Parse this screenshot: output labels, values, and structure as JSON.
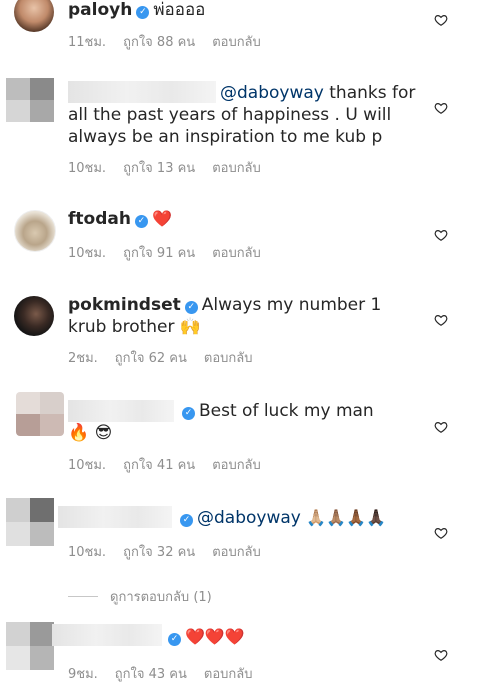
{
  "comments": [
    {
      "username": "paloyh",
      "text": "พ่ออออ",
      "time": "11ชม.",
      "likes": "ถูกใจ 88 คน",
      "reply": "ตอบกลับ"
    },
    {
      "username": "",
      "mention": "@daboyway",
      "text": "thanks for all the past years of happiness . U will always be an inspiration to me kub p",
      "time": "10ชม.",
      "likes": "ถูกใจ 13 คน",
      "reply": "ตอบกลับ"
    },
    {
      "username": "ftodah",
      "text": "❤️",
      "time": "10ชม.",
      "likes": "ถูกใจ 91 คน",
      "reply": "ตอบกลับ"
    },
    {
      "username": "pokmindset",
      "text": "Always my number 1 krub brother 🙌",
      "time": "2ชม.",
      "likes": "ถูกใจ 62 คน",
      "reply": "ตอบกลับ"
    },
    {
      "username": "",
      "text": "Best of luck my man 🔥 😎",
      "time": "10ชม.",
      "likes": "ถูกใจ 41 คน",
      "reply": "ตอบกลับ"
    },
    {
      "username": "",
      "mention": "@daboyway",
      "text": "🙏🏼🙏🏽🙏🏾🙏🏿",
      "time": "10ชม.",
      "likes": "ถูกใจ 32 คน",
      "reply": "ตอบกลับ"
    },
    {
      "username": "",
      "text": "❤️❤️❤️",
      "time": "9ชม.",
      "likes": "ถูกใจ 43 คน",
      "reply": "ตอบกลับ"
    }
  ],
  "view_replies": "ดูการตอบกลับ (1)",
  "icons": {
    "like": "heart-outline-icon",
    "verified": "verified-badge-icon"
  }
}
